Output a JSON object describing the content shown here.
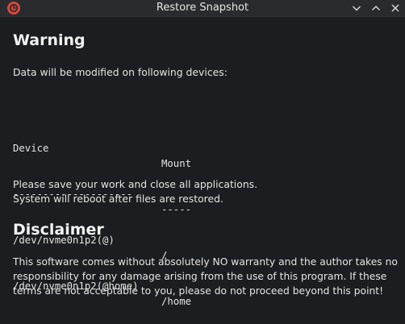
{
  "window": {
    "title": "Restore Snapshot",
    "app_icon": "timeshift-icon",
    "controls": {
      "minimize_icon": "chevron-down-icon",
      "maximize_icon": "chevron-up-icon",
      "close_icon": "close-icon"
    }
  },
  "warning": {
    "heading": "Warning",
    "intro": "Data will be modified on following devices:",
    "table": {
      "headers": [
        "Device",
        "Mount"
      ],
      "separators": [
        "--------------------",
        "-----"
      ],
      "rows": [
        [
          "/dev/nvme0n1p2(@)",
          "/"
        ],
        [
          "/dev/nvme0n1p2(@home)",
          "/home"
        ]
      ]
    },
    "notice_line1": "Please save your work and close all applications.",
    "notice_line2": "System will reboot after files are restored."
  },
  "disclaimer": {
    "heading": "Disclaimer",
    "body": "This software comes without absolutely NO warranty and the author takes no responsibility for any damage arising from the use of this program. If these terms are not acceptable to you, please do not proceed beyond this point!"
  },
  "colors": {
    "background": "#1c1d20",
    "titlebar": "#2a2b2e",
    "text": "#e4e4e4",
    "app_icon": "#d9473f"
  }
}
